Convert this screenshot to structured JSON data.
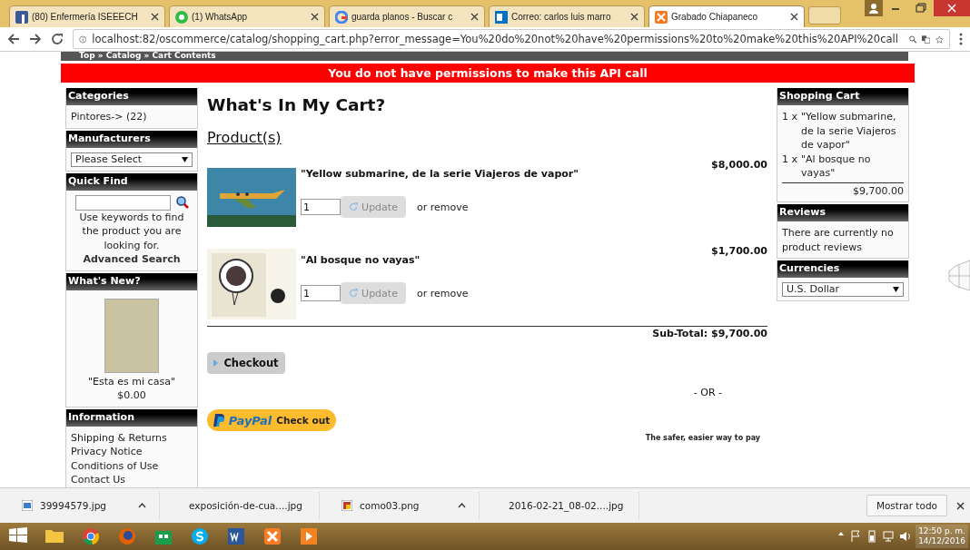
{
  "browser": {
    "tabs": [
      {
        "title": "(80) Enfermería ISEEECH",
        "selected": false
      },
      {
        "title": "(1) WhatsApp",
        "selected": false
      },
      {
        "title": "guarda planos - Buscar c",
        "selected": false
      },
      {
        "title": "Correo: carlos luis marro",
        "selected": false
      },
      {
        "title": "Grabado Chiapaneco",
        "selected": true
      }
    ],
    "address": "localhost:82/oscommerce/catalog/shopping_cart.php?error_message=You%20do%20not%20have%20permissions%20to%20make%20this%20API%20call"
  },
  "breadcrumb": "Top » Catalog » Cart Contents",
  "error_message": "You do not have permissions to make this API call",
  "left_column": [
    {
      "kind": "links",
      "title": "Categories",
      "items": [
        "Pintores-> (22)"
      ]
    },
    {
      "kind": "select",
      "title": "Manufacturers",
      "value": "Please Select"
    },
    {
      "kind": "search",
      "title": "Quick Find",
      "hint": "Use keywords to find the product you are looking for.",
      "link": "Advanced Search"
    },
    {
      "kind": "product",
      "title": "What's New?",
      "caption": "\"Esta es mi casa\"",
      "price": "$0.00"
    },
    {
      "kind": "links",
      "title": "Information",
      "items": [
        "Shipping & Returns",
        "Privacy Notice",
        "Conditions of Use",
        "Contact Us"
      ]
    }
  ],
  "main": {
    "title": "What's In My Cart?",
    "section": "Product(s)",
    "products": [
      {
        "name": "\"Yellow submarine, de la serie Viajeros de vapor\"",
        "price": "$8,000.00",
        "quantity": "1",
        "update": "Update",
        "remove": "or remove"
      },
      {
        "name": "\"Al bosque no vayas\"",
        "price": "$1,700.00",
        "quantity": "1",
        "update": "Update",
        "remove": "or remove"
      }
    ],
    "subtotal": "Sub-Total: $9,700.00",
    "checkout": "Checkout",
    "or": "- OR -",
    "paypal": {
      "brand": "PayPal",
      "action": "Check out",
      "tagline": "The safer, easier way to pay"
    }
  },
  "right_column": [
    {
      "kind": "cart",
      "title": "Shopping Cart",
      "items": [
        {
          "qty": "1 x",
          "name": "\"Yellow submarine, de la serie Viajeros de vapor\""
        },
        {
          "qty": "1 x",
          "name": "\"Al bosque no vayas\""
        }
      ],
      "total": "$9,700.00"
    },
    {
      "kind": "text",
      "title": "Reviews",
      "text": "There are currently no product reviews"
    },
    {
      "kind": "select",
      "title": "Currencies",
      "value": "U.S. Dollar"
    }
  ],
  "downloads": {
    "files": [
      {
        "name": "39994579.jpg",
        "kind": "jpg"
      },
      {
        "name": "exposición-de-cua....jpg",
        "kind": "jpg"
      },
      {
        "name": "como03.png",
        "kind": "png"
      },
      {
        "name": "2016-02-21_08-02....jpg",
        "kind": "jpg"
      }
    ],
    "show_all": "Mostrar todo"
  },
  "taskbar": {
    "time": "12:50 p. m.",
    "date": "14/12/2016"
  }
}
